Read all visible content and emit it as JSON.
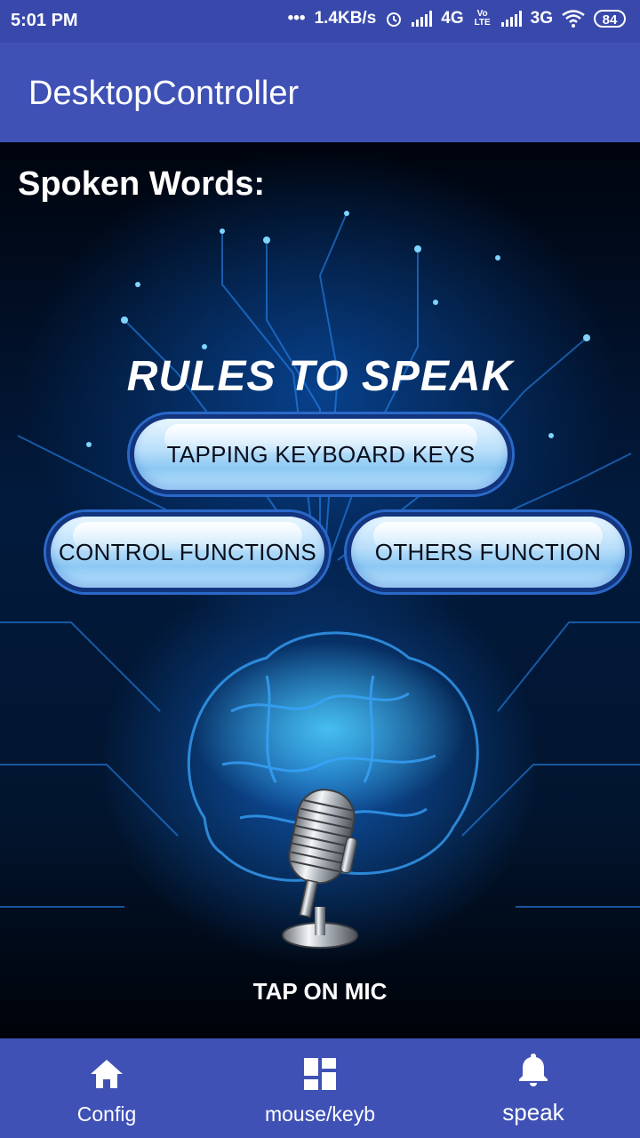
{
  "status_bar": {
    "time": "5:01 PM",
    "dots": "•••",
    "net_speed": "1.4KB/s",
    "net_4g": "4G",
    "volte": "Vo LTE",
    "net_3g": "3G",
    "battery": "84"
  },
  "app_bar": {
    "title": "DesktopController"
  },
  "main": {
    "spoken_label": "Spoken Words:",
    "rules_title": "RULES TO SPEAK",
    "buttons": {
      "keys": "TAPPING KEYBOARD KEYS",
      "control": "CONTROL FUNCTIONS",
      "others": "OTHERS FUNCTION"
    },
    "tap_label": "TAP ON MIC"
  },
  "bottom_nav": {
    "items": [
      {
        "label": "Config",
        "icon": "home-icon"
      },
      {
        "label": "mouse/keyb",
        "icon": "dashboard-icon"
      },
      {
        "label": "speak",
        "icon": "bell-icon",
        "active": true
      }
    ]
  }
}
